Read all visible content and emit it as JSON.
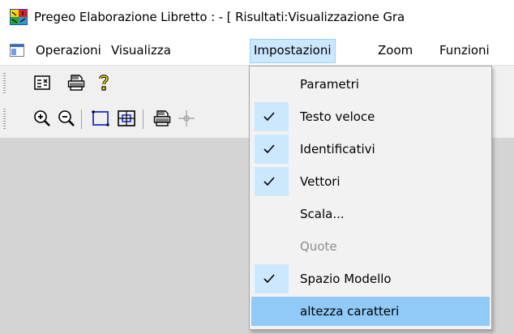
{
  "window": {
    "title": "Pregeo Elaborazione Libretto : - [ Risultati:Visualizzazione Gra"
  },
  "menubar": {
    "items": [
      {
        "label": "Operazioni"
      },
      {
        "label": "Visualizza"
      },
      {
        "label": "Impostazioni",
        "active": true
      },
      {
        "label": "Zoom"
      },
      {
        "label": "Funzioni"
      }
    ]
  },
  "toolbar1": {
    "icons": [
      "properties-icon",
      "print-icon",
      "help-icon"
    ]
  },
  "toolbar2": {
    "icons": [
      "zoom-in-icon",
      "zoom-out-icon",
      "zoom-window-icon",
      "zoom-extents-icon",
      "print-icon",
      "crosshair-icon"
    ]
  },
  "dropdown": {
    "items": [
      {
        "label": "Parametri",
        "checked": false,
        "disabled": false
      },
      {
        "label": "Testo veloce",
        "checked": true,
        "disabled": false
      },
      {
        "label": "Identificativi",
        "checked": true,
        "disabled": false
      },
      {
        "label": "Vettori",
        "checked": true,
        "disabled": false
      },
      {
        "label": "Scala...",
        "checked": false,
        "disabled": false
      },
      {
        "label": "Quote",
        "checked": false,
        "disabled": true
      },
      {
        "label": "Spazio Modello",
        "checked": true,
        "disabled": false
      },
      {
        "label": "altezza caratteri",
        "checked": false,
        "disabled": false,
        "highlighted": true
      }
    ]
  },
  "colors": {
    "menu_active_bg": "#cce8ff",
    "menu_highlight_bg": "#91c9f7",
    "client_bg": "#d4d4d4",
    "toolbar_bg": "#f0f0f0"
  }
}
